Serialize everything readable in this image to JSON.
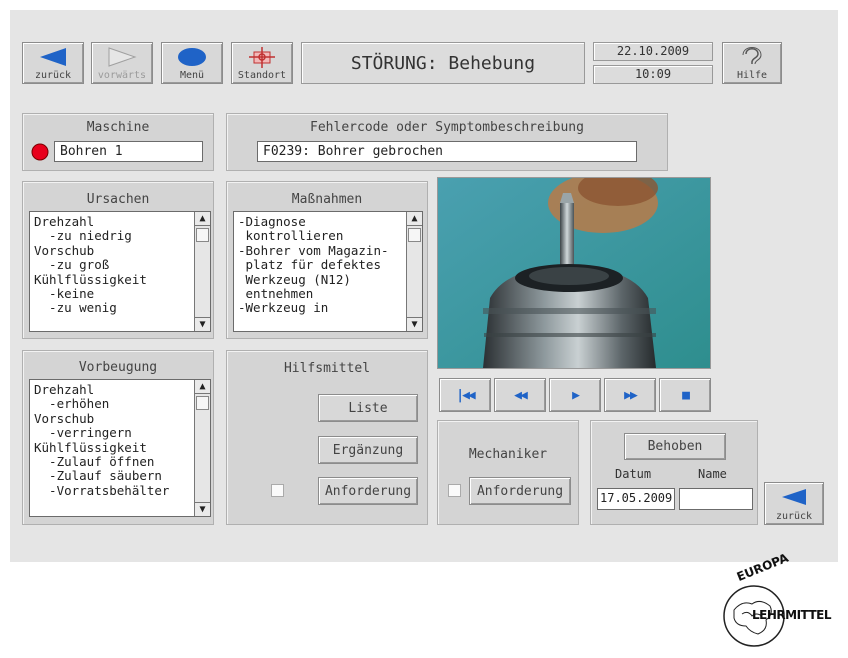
{
  "toolbar": {
    "back_label": "zurück",
    "forward_label": "vorwärts",
    "menu_label": "Menü",
    "location_label": "Standort",
    "help_label": "Hilfe"
  },
  "header": {
    "title": "STÖRUNG: Behebung",
    "date": "22.10.2009",
    "time": "10:09"
  },
  "machine": {
    "title": "Maschine",
    "value": "Bohren 1",
    "status_color": "#e8001c"
  },
  "fault": {
    "title": "Fehlercode oder Symptombeschreibung",
    "value": "F0239: Bohrer gebrochen"
  },
  "causes": {
    "title": "Ursachen",
    "text": "Drehzahl\n  -zu niedrig\nVorschub\n  -zu groß\nKühlflüssigkeit\n  -keine\n  -zu wenig"
  },
  "measures": {
    "title": "Maßnahmen",
    "text": "-Diagnose\n kontrollieren\n-Bohrer vom Magazin-\n platz für defektes\n Werkzeug (N12)\n entnehmen\n-Werkzeug in"
  },
  "prevention": {
    "title": "Vorbeugung",
    "text": "Drehzahl\n  -erhöhen\nVorschub\n  -verringern\nKühlflüssigkeit\n  -Zulauf öffnen\n  -Zulauf säubern\n  -Vorratsbehälter"
  },
  "aids": {
    "title": "Hilfsmittel",
    "list_label": "Liste",
    "supplement_label": "Ergänzung",
    "request_label": "Anforderung"
  },
  "mechanic": {
    "title": "Mechaniker",
    "request_label": "Anforderung"
  },
  "resolved": {
    "button_label": "Behoben",
    "date_label": "Datum",
    "name_label": "Name",
    "date_value": "17.05.2009",
    "name_value": "",
    "back_label": "zurück"
  },
  "media": {
    "controls": [
      "skip-to-start",
      "rewind",
      "play",
      "fast-forward",
      "stop"
    ],
    "accent_color": "#1f63c7"
  },
  "logo": {
    "text_top": "EUROPA",
    "text_bottom": "LEHRMITTEL"
  }
}
